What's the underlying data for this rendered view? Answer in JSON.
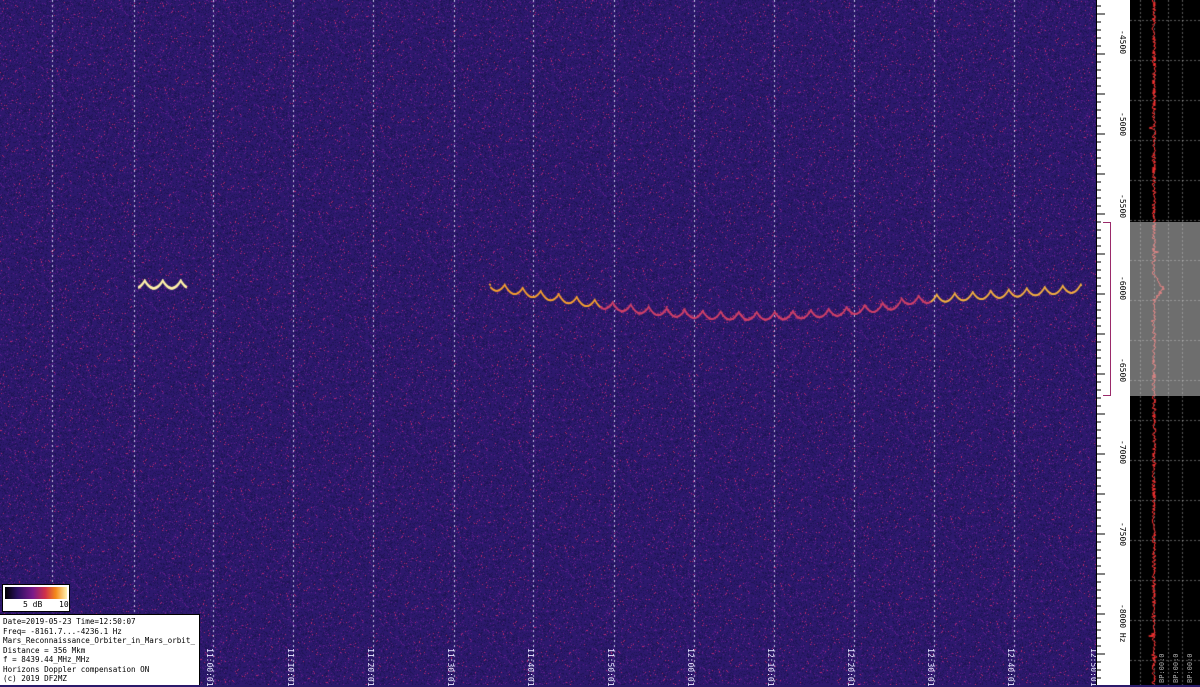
{
  "freq_axis": {
    "ticks": [
      "-4500",
      "-5000",
      "-5500",
      "-6000",
      "-6500",
      "-7000",
      "-7500",
      "-8000 Hz"
    ]
  },
  "time_axis": {
    "ticks": [
      "11:00:01",
      "11:10:01",
      "11:20:01",
      "11:30:01",
      "11:40:01",
      "11:50:01",
      "12:00:01",
      "12:10:01",
      "12:20:01",
      "12:30:01",
      "12:40:01",
      "12:50:01"
    ]
  },
  "colorbar": {
    "label": "5 dB",
    "max_label": "10"
  },
  "info": {
    "line1": "Date=2019-05-23 Time=12:50:07",
    "line2": "Freq= -8161.7...-4236.1 Hz",
    "line3": "Mars_Reconnaissance_Orbiter_in_Mars_orbit_",
    "line4": "Distance = 356 Mkm",
    "line5": "f = 8439.44_MHz_MHz",
    "line6": "Horizons Doppler compensation ON",
    "line7": "(c) 2019 DF2MZ"
  },
  "spectrum_labels": [
    "BP:00:0",
    "BP:00:0",
    "BP:00:0"
  ],
  "colors": {
    "background": "#2a1a6a",
    "trace": "#ff3030",
    "signal_bright": "#fff0a0",
    "signal_dim": "#d04070"
  }
}
